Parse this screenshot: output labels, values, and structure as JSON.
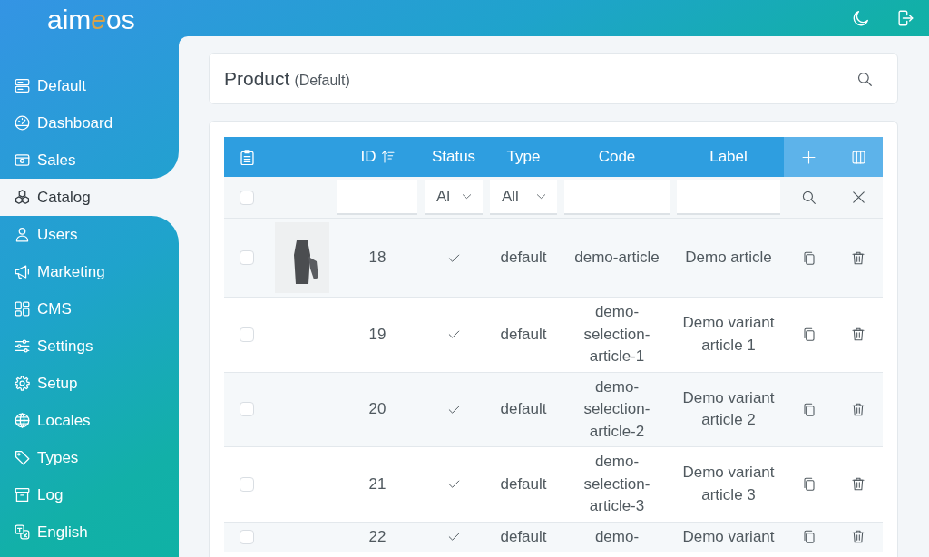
{
  "logo": [
    {
      "text": "aim",
      "accent": false
    },
    {
      "text": "e",
      "accent": true
    },
    {
      "text": "os",
      "accent": false
    }
  ],
  "sidebar": {
    "items": [
      {
        "label": "Default",
        "selected": false
      },
      {
        "label": "Dashboard",
        "selected": false
      },
      {
        "label": "Sales",
        "selected": false
      },
      {
        "label": "Catalog",
        "selected": true
      },
      {
        "label": "Users",
        "selected": false
      },
      {
        "label": "Marketing",
        "selected": false
      },
      {
        "label": "CMS",
        "selected": false
      },
      {
        "label": "Settings",
        "selected": false
      },
      {
        "label": "Setup",
        "selected": false
      },
      {
        "label": "Locales",
        "selected": false
      },
      {
        "label": "Types",
        "selected": false
      },
      {
        "label": "Log",
        "selected": false
      },
      {
        "label": "English",
        "selected": false
      }
    ]
  },
  "header": {
    "title": "Product",
    "site": "(Default)"
  },
  "table": {
    "columns": [
      {
        "label": "ID",
        "sorted": true
      },
      {
        "label": "Status",
        "sorted": false
      },
      {
        "label": "Type",
        "sorted": false
      },
      {
        "label": "Code",
        "sorted": false
      },
      {
        "label": "Label",
        "sorted": false
      }
    ],
    "select_all": {
      "checked": false
    },
    "filters": [
      {
        "kind": "input"
      },
      {
        "kind": "select",
        "value": "Al"
      },
      {
        "kind": "select",
        "value": "All"
      },
      {
        "kind": "input"
      },
      {
        "kind": "input"
      }
    ],
    "rows": [
      {
        "checked": false,
        "has_image": true,
        "id": "18",
        "enabled": true,
        "type": "default",
        "code": "demo-article",
        "label": "Demo article"
      },
      {
        "checked": false,
        "has_image": false,
        "id": "19",
        "enabled": true,
        "type": "default",
        "code": "demo-selection-article-1",
        "label": "Demo variant article 1"
      },
      {
        "checked": false,
        "has_image": false,
        "id": "20",
        "enabled": true,
        "type": "default",
        "code": "demo-selection-article-2",
        "label": "Demo variant article 2"
      },
      {
        "checked": false,
        "has_image": false,
        "id": "21",
        "enabled": true,
        "type": "default",
        "code": "demo-selection-article-3",
        "label": "Demo variant article 3"
      },
      {
        "checked": false,
        "has_image": false,
        "id": "22",
        "enabled": true,
        "type": "default",
        "code": "demo-",
        "label": "Demo variant"
      }
    ]
  }
}
